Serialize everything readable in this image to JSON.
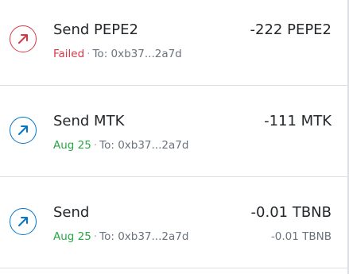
{
  "transactions": [
    {
      "title": "Send PEPE2",
      "status": "Failed",
      "to_label": "To: 0xb37...2a7d",
      "amount": "-222 PEPE2",
      "secondary_amount": "",
      "icon": "send-arrow-icon",
      "status_color": "#d73847"
    },
    {
      "title": "Send MTK",
      "status": "Aug 25",
      "to_label": "To: 0xb37...2a7d",
      "amount": "-111 MTK",
      "secondary_amount": "",
      "icon": "send-arrow-icon",
      "status_color": "#28a745"
    },
    {
      "title": "Send",
      "status": "Aug 25",
      "to_label": "To: 0xb37...2a7d",
      "amount": "-0.01 TBNB",
      "secondary_amount": "-0.01 TBNB",
      "icon": "send-arrow-icon",
      "status_color": "#28a745"
    }
  ],
  "separator": "·"
}
